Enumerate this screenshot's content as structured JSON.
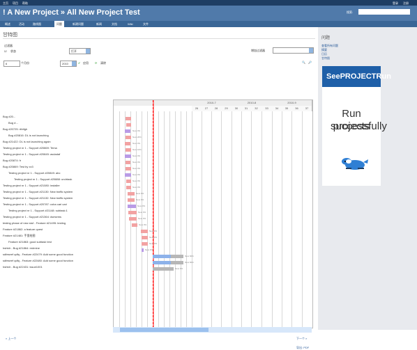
{
  "top": {
    "left": [
      "主页",
      "项目",
      "帮助"
    ],
    "right": [
      "登录",
      "注册"
    ]
  },
  "header": {
    "title": "! A New Project » All New Project Test",
    "search_label": "搜索:"
  },
  "menu": {
    "tabs": [
      "概述",
      "活动",
      "路线图",
      "问题",
      "新建问题",
      "新闻",
      "文档",
      "Wiki",
      "文件"
    ],
    "active": "问题"
  },
  "page": {
    "title": "甘特图",
    "filters_label": "过滤器",
    "status_label": "状态",
    "status_value": "打开",
    "add_filter_label": "增加过滤器",
    "months_value": "6",
    "months_label": "个月份",
    "year_value": "2010",
    "apply": "应用",
    "clear": "清除",
    "prev": "« 上一个",
    "next": "下一个 »",
    "export": "导出: PDF"
  },
  "gantt": {
    "months": [
      "2010-7",
      "2010-8",
      "2010-9"
    ],
    "days": [
      "26",
      "27",
      "28",
      "29",
      "30",
      "31",
      "32",
      "33",
      "34",
      "35",
      "36",
      "37",
      "38",
      "39",
      "40"
    ],
    "rows": [
      "Bug #20...",
      "Bug #...",
      "Bug #20725: rthtfgh",
      "Bug #20816: DL is not launching",
      "Bug #21422: DL is not launching again",
      "Testing project nr 1 - Support #20869: Tema",
      "Testing project nr 1 - Support #20845: asdadaf",
      "Bug #20874: fr",
      "Bug #20869: Test by xx3",
      "Testing project nr 1 - Support #20849: abc",
      "Testing project nr 1 - Support #20888: undrtask",
      "Testing project nr 1 - Support #21080: installer",
      "Testing project nr 1 - Support #21130: New traffic system",
      "Testing project nr 1 - Support #21132: New traffic system",
      "Testing project nr 1 - Support #20787: coba cari cari",
      "Testing project nr 1 - Support #21148: subtask:1",
      "Testing project nr 1 - Support #21364: dsesems",
      "testing phase of new stuf - Feature #21495: testing",
      "Feature #21862: a feature quest",
      "Feature #21481: 手里绘图",
      "Feature #21863: good subtask test",
      "hshtdr - Bug #21864: redmine",
      "sdfeseef qdfq - Feature #22479: Add some good function",
      "sdfeseef qdfq - Feature #22480: Add some good function",
      "hshtdr - Bug #22431: issue1001"
    ],
    "bar_labels": [
      "New 0%",
      "New 20%",
      "New 0%",
      "New 10%",
      "New 0%",
      "New 0%",
      "New 0%",
      "New 0%",
      "New 0%",
      "New 0%",
      "New 0%",
      "New 0%",
      "New 0%",
      "New 0%",
      "New 0%",
      "New 0%",
      "New 0%",
      "New 0%",
      "New 0%",
      "New 0%",
      "New 60%",
      "New 60%",
      "New 0%"
    ]
  },
  "sidebar": {
    "title": "问题",
    "links": [
      "查看所有问题",
      "摘要",
      "日历",
      "甘特图"
    ],
    "ad_title": "SeePROJECTRun",
    "ad_line1": "Run projects",
    "ad_line2": "successfully"
  }
}
